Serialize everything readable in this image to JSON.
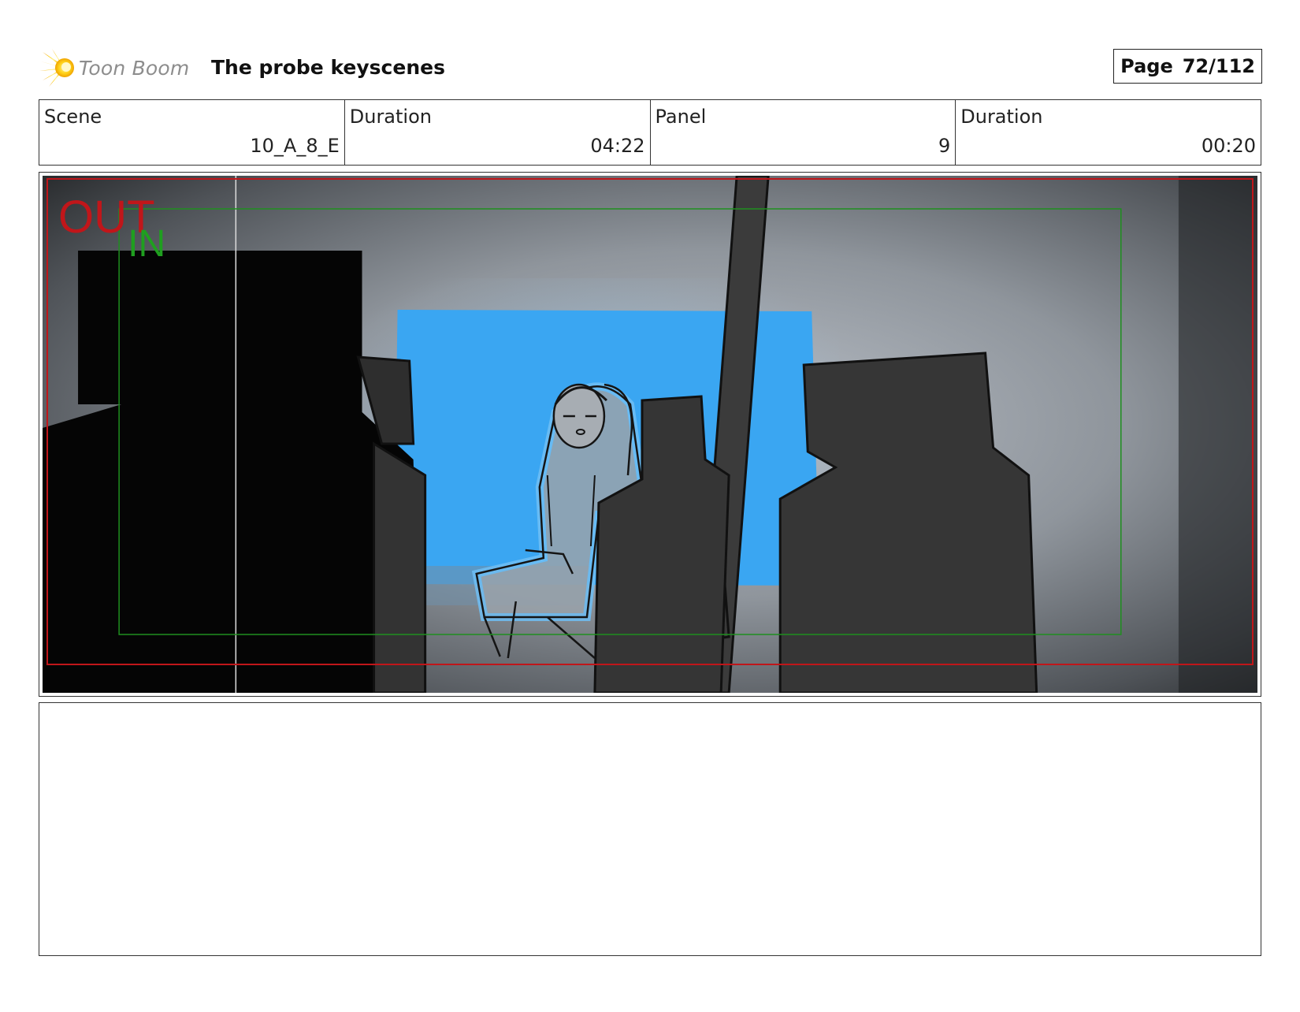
{
  "header": {
    "logo_text": "Toon Boom",
    "logo_icon": "toon-boom-burst-icon",
    "title": "The probe keyscenes",
    "page_label": "Page",
    "page_value": "72/112"
  },
  "info": {
    "scene_label": "Scene",
    "scene_value": "10_A_8_E",
    "scene_duration_label": "Duration",
    "scene_duration_value": "04:22",
    "panel_label": "Panel",
    "panel_value": "9",
    "panel_duration_label": "Duration",
    "panel_duration_value": "00:20"
  },
  "panel": {
    "out_label": "OUT",
    "in_label": "IN",
    "colors": {
      "out_frame": "#c0161a",
      "in_frame": "#1f8f1f",
      "window_blue": "#3aa6f2",
      "silhouette": "#2c2c2c"
    }
  },
  "notes": {
    "text": ""
  }
}
